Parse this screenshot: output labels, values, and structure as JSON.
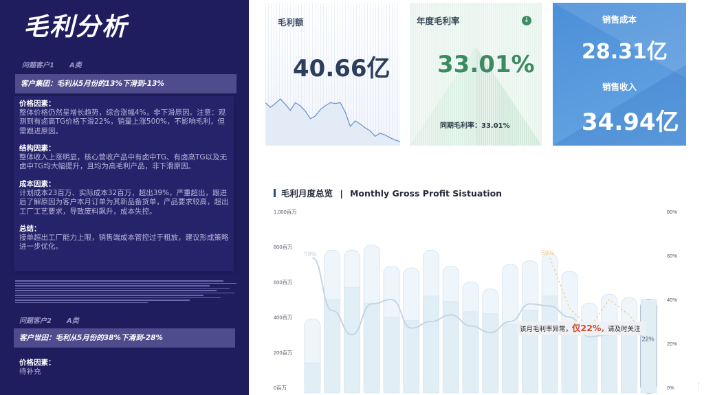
{
  "left_panel": {
    "title": "毛利分析",
    "customer1": {
      "tag": "问题客户1",
      "type": "A类",
      "group_headline": "客户集团：毛利从5月份的13%下滑到-13%",
      "sections": [
        {
          "heading": "价格因素：",
          "text": "整体价格仍然呈增长趋势，综合涨幅4%，非下滑原因。注意：观测到有卤高TG价格下滑22%，销量上涨500%，不影响毛利，但需跟进原因。"
        },
        {
          "heading": "结构因素：",
          "text": "整体收入上涨明显，核心营收产品中有卤中TG、有卤高TG以及无卤中TG均大幅提升，且均为高毛利产品，非下滑原因。"
        },
        {
          "heading": "成本因素：",
          "text": "计划成本23百万、实际成本32百万，超出39%，严重超出，跟进后了解原因为客户本月订单为其新品备货单，产品要求较高，超出工厂工艺要求，导致废料飙升，成本失控。"
        },
        {
          "heading": "总结：",
          "text": "接单超出工厂能力上限，销售端成本管控过于粗放，建议形成策略进一步优化。"
        }
      ]
    },
    "customer2": {
      "tag": "问题客户2",
      "type": "A类",
      "group_headline": "客户世田：毛利从5月份的38%下滑到-28%",
      "sections": [
        {
          "heading": "价格因素：",
          "text": "待补充"
        }
      ]
    }
  },
  "kpis": {
    "gross_profit": {
      "label": "毛利额",
      "value": "40.66亿"
    },
    "annual_margin": {
      "label": "年度毛利率",
      "value": "33.01%",
      "yoy_label": "同期毛利率：",
      "yoy_value": "33.01%",
      "trend_icon": "down-arrow-icon"
    },
    "sales_cost": {
      "label": "销售成本",
      "value": "28.31亿"
    },
    "sales_revenue": {
      "label": "销售收入",
      "value": "34.94亿"
    }
  },
  "chart_title": {
    "cn": "毛利月度总览",
    "sep": "|",
    "en": "Monthly Gross Profit Sistuation"
  },
  "chart_data": {
    "type": "bar",
    "title": "毛利月度总览 | Monthly Gross Profit Sistuation",
    "y_ticks": [
      "0百万",
      "200百万",
      "400百万",
      "600百万",
      "800百万",
      "1,000百万"
    ],
    "y2_ticks": [
      "0%",
      "20%",
      "40%",
      "60%",
      "80%"
    ],
    "ylim": [
      0,
      1000
    ],
    "y2lim": [
      0,
      80
    ],
    "series": [
      {
        "values": [
          390,
          780,
          780,
          810,
          690,
          680,
          780,
          690,
          600,
          560,
          700,
          720,
          760,
          660,
          480,
          530,
          510,
          500
        ]
      },
      {
        "values": [
          140,
          500,
          570,
          480,
          400,
          380,
          520,
          490,
          430,
          420,
          360,
          440,
          520,
          360,
          320,
          360,
          370,
          500
        ]
      },
      {
        "values": [
          59,
          35,
          24,
          38,
          40,
          27,
          30,
          33,
          28,
          25,
          30,
          38,
          37,
          32,
          23,
          24,
          27,
          22
        ]
      }
    ],
    "dashed_line": [
      59,
      57,
      56,
      55,
      54,
      53,
      52,
      51,
      50,
      49,
      48,
      47,
      59,
      36,
      27,
      40,
      33,
      22
    ],
    "labels": {
      "first": "59%",
      "peak": "59%",
      "last": "22%"
    },
    "annotation": {
      "prefix": "该月毛利率异常，",
      "highlight": "仅22%",
      "suffix": "，请及时关注"
    },
    "colors": {
      "bar_outer": "#eef6fb",
      "bar_inner": "#e1eef6",
      "bar_stroke": "#d3e2ed",
      "line": "#c4d5e3",
      "dashed": "#f3c98a",
      "highlight_bar": "#2a3f6b",
      "annotation_red": "#d24a2e"
    }
  },
  "sparkline_data": [
    150,
    138,
    148,
    160,
    146,
    130,
    150,
    142,
    128,
    108,
    115,
    132,
    142,
    150,
    148,
    150,
    126,
    88,
    102,
    94,
    84,
    76,
    62,
    70,
    65,
    58,
    52,
    48
  ]
}
